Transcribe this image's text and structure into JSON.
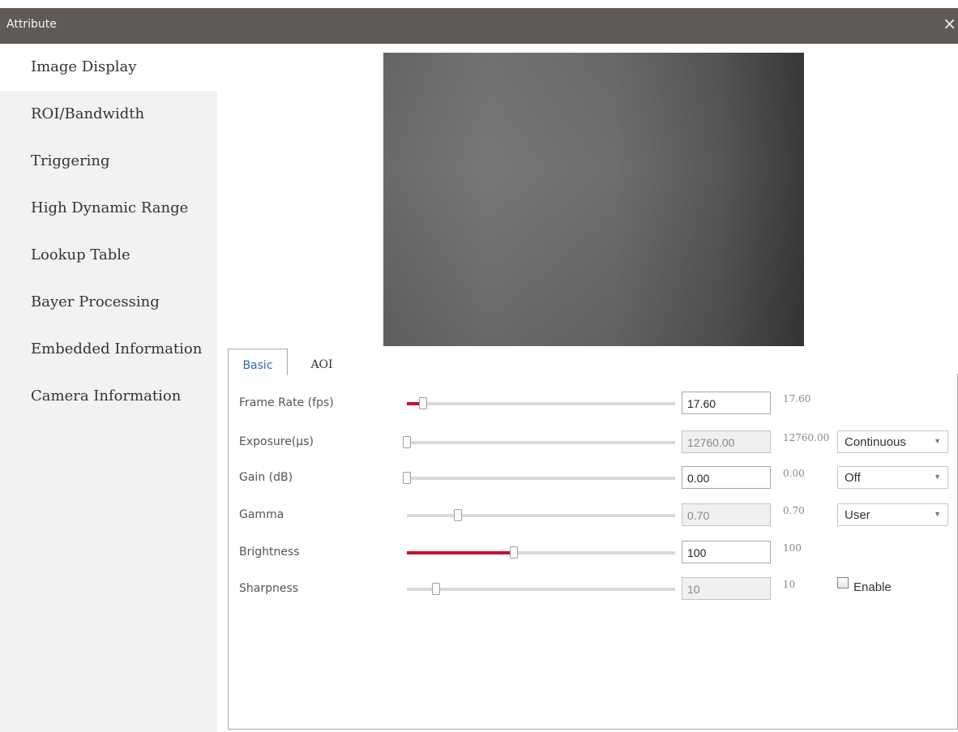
{
  "window": {
    "title": "Attribute",
    "close_glyph": "×"
  },
  "sidebar": {
    "items": [
      {
        "label": "Image Display",
        "active": true
      },
      {
        "label": "ROI/Bandwidth"
      },
      {
        "label": "Triggering"
      },
      {
        "label": "High Dynamic Range"
      },
      {
        "label": "Lookup Table"
      },
      {
        "label": "Bayer Processing"
      },
      {
        "label": "Embedded Information"
      },
      {
        "label": "Camera Information"
      }
    ]
  },
  "tabs": [
    {
      "label": "Basic",
      "active": true
    },
    {
      "label": "AOI"
    }
  ],
  "params": [
    {
      "label": "Frame Rate (fps)",
      "value": "17.60",
      "hint": "17.60",
      "slider_fraction": 0.06,
      "readonly": false
    },
    {
      "label": "Exposure(µs)",
      "value": "12760.00",
      "hint": "12760.00",
      "slider_fraction": 0.0,
      "readonly": true,
      "mode": "Continuous"
    },
    {
      "label": "Gain (dB)",
      "value": "0.00",
      "hint": "0.00",
      "slider_fraction": 0.0,
      "readonly": false,
      "mode": "Off"
    },
    {
      "label": "Gamma",
      "value": "0.70",
      "hint": "0.70",
      "slider_fraction": 0.19,
      "readonly": true,
      "mode": "User"
    },
    {
      "label": "Brightness",
      "value": "100",
      "hint": "100",
      "slider_fraction": 0.4,
      "readonly": false
    },
    {
      "label": "Sharpness",
      "value": "10",
      "hint": "10",
      "slider_fraction": 0.11,
      "readonly": true,
      "enable_label": "Enable",
      "enabled": false
    }
  ],
  "colors": {
    "titlebar": "#5f5a55",
    "slider_fill": "#c8102e",
    "tab_active_text": "#2a6ab8",
    "sidebar_bg": "#f2f2f2"
  }
}
